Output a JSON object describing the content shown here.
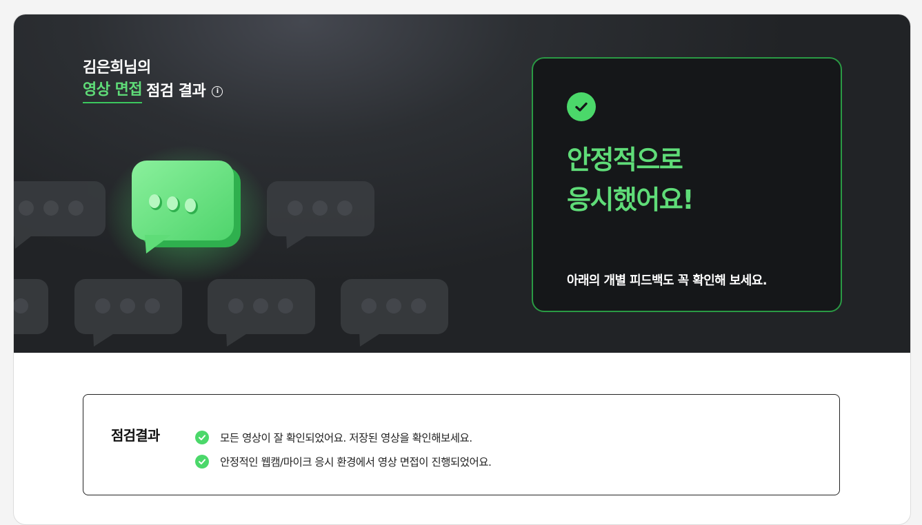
{
  "hero": {
    "title_line1": "김은희님의",
    "title_highlight": "영상 면접",
    "title_rest": "점검 결과",
    "info_glyph": "i"
  },
  "result_panel": {
    "status_icon": "check-icon",
    "headline_line1": "안정적으로",
    "headline_line2": "응시했어요!",
    "subtext": "아래의 개별 피드백도 꼭 확인해 보세요."
  },
  "summary": {
    "label": "점검결과",
    "items": [
      "모든 영상이 잘 확인되었어요. 저장된 영상을 확인해보세요.",
      "안정적인 웹캠/마이크 응시 환경에서 영상 면접이 진행되었어요."
    ]
  },
  "colors": {
    "accent_green": "#5fdc78",
    "check_green": "#4bd86a",
    "panel_border": "#2a9a44",
    "hero_bg": "#2c2f33"
  }
}
